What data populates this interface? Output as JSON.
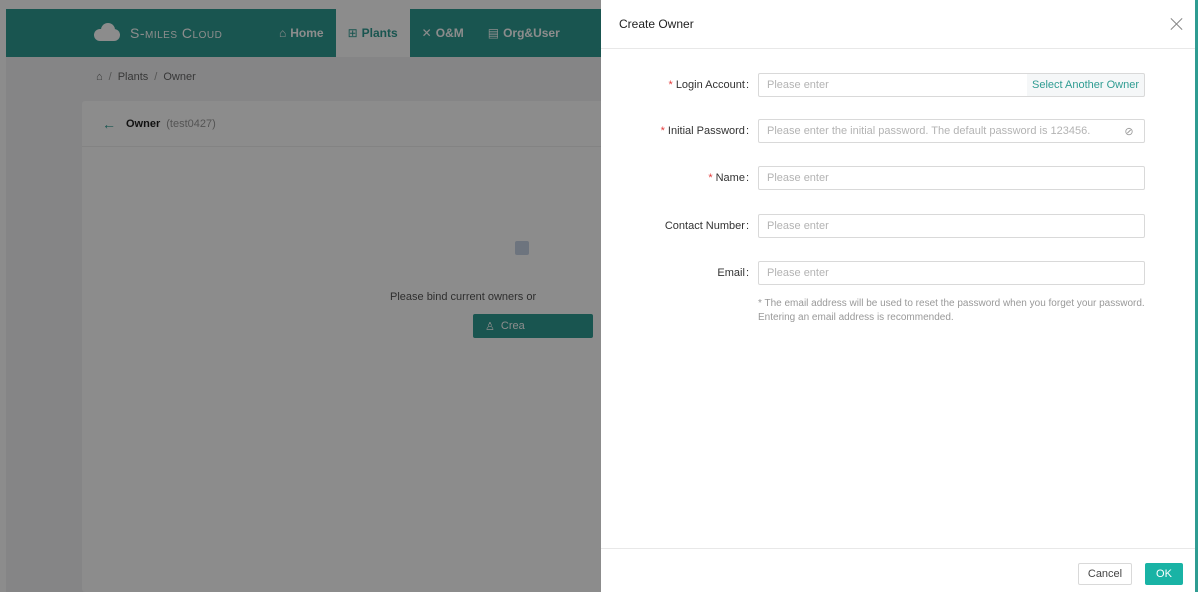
{
  "app": {
    "logo_text": "S-miles Cloud",
    "nav": [
      {
        "icon": "home-icon",
        "glyph": "⌂",
        "label": "Home"
      },
      {
        "icon": "plants-icon",
        "glyph": "⊞",
        "label": "Plants"
      },
      {
        "icon": "tools-icon",
        "glyph": "✕",
        "label": "O&M"
      },
      {
        "icon": "org-icon",
        "glyph": "▤",
        "label": "Org&User"
      }
    ],
    "active_nav": "Plants",
    "breadcrumb": [
      "Plants",
      "Owner"
    ],
    "breadcrumb_separator": "/",
    "card": {
      "title": "Owner",
      "subtitle": "(test0427)",
      "empty_text": "Please bind current owners or",
      "create_button": "Crea"
    }
  },
  "drawer": {
    "title": "Create Owner",
    "fields": {
      "login_account": {
        "label": "Login Account",
        "required": true,
        "placeholder": "Please enter",
        "addon": "Select Another Owner"
      },
      "initial_password": {
        "label": "Initial Password",
        "required": true,
        "placeholder": "Please enter the initial password. The default password is 123456."
      },
      "name": {
        "label": "Name",
        "required": true,
        "placeholder": "Please enter"
      },
      "contact_number": {
        "label": "Contact Number",
        "required": false,
        "placeholder": "Please enter"
      },
      "email": {
        "label": "Email",
        "required": false,
        "placeholder": "Please enter"
      }
    },
    "email_hint": "* The email address will be used to reset the password when you forget your password. Entering an email address is recommended.",
    "cancel_label": "Cancel",
    "ok_label": "OK"
  },
  "colors": {
    "brand": "#2f9c92",
    "primary_button": "#19b3a5",
    "required": "#e43b3b"
  }
}
